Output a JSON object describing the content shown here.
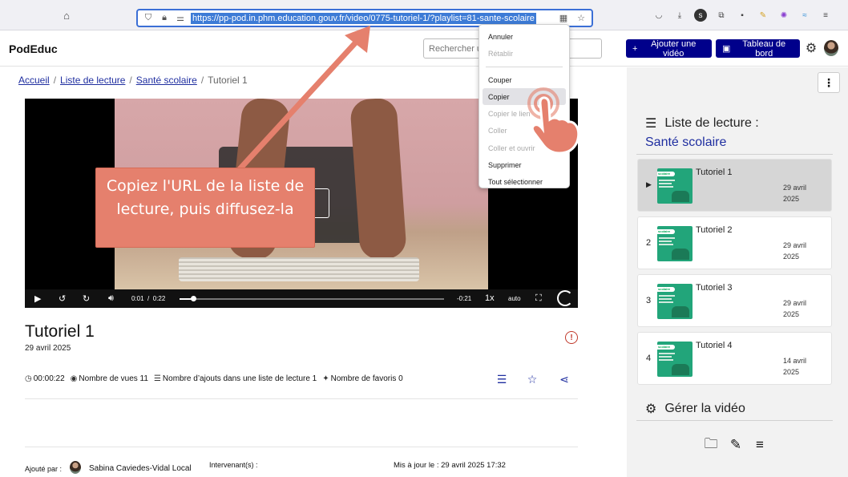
{
  "browser": {
    "url": "https://pp-pod.in.phm.education.gouv.fr/video/0775-tutoriel-1/?playlist=81-sante-scolaire"
  },
  "header": {
    "brand": "PodEduc",
    "search_placeholder": "Rechercher un",
    "add_video_label": "Ajouter une vidéo",
    "dashboard_label": "Tableau de bord"
  },
  "breadcrumb": {
    "home": "Accueil",
    "playlists": "Liste de lecture",
    "playlist": "Santé scolaire",
    "current": "Tutoriel 1"
  },
  "player": {
    "time_current": "0:01",
    "time_separator": "/",
    "time_total": "0:22",
    "time_remaining": "-0:21",
    "speed": "1x",
    "quality": "auto",
    "progress": 0.05
  },
  "callout": {
    "text": "Copiez l'URL de la liste de lecture, puis diffusez-la"
  },
  "context_menu": {
    "items": [
      {
        "label": "Annuler",
        "disabled": false
      },
      {
        "label": "Rétablir",
        "disabled": true
      },
      {
        "label": "Couper",
        "disabled": false
      },
      {
        "label": "Copier",
        "disabled": false
      },
      {
        "label": "Copier le lien",
        "disabled": true
      },
      {
        "label": "Coller",
        "disabled": true
      },
      {
        "label": "Coller et ouvrir",
        "disabled": true
      },
      {
        "label": "Supprimer",
        "disabled": false
      },
      {
        "label": "Tout sélectionner",
        "disabled": false
      }
    ]
  },
  "video": {
    "title": "Tutoriel 1",
    "date": "29 avril 2025",
    "duration": "00:00:22",
    "views": "Nombre de vues 11",
    "playlist_adds": "Nombre d’ajouts dans une liste de lecture 1",
    "favorites": "Nombre de favoris 0",
    "added_by_label": "Ajouté par :",
    "added_by_name": "Sabina Caviedes-Vidal Local",
    "speakers_label": "Intervenant(s) :",
    "updated": "Mis à jour le : 29 avril 2025 17:32"
  },
  "sidebar": {
    "playlist_heading": "Liste de lecture :",
    "playlist_name": "Santé scolaire",
    "items": [
      {
        "num": "▶",
        "title": "Tutoriel 1",
        "date": "29 avril 2025",
        "active": true
      },
      {
        "num": "2",
        "title": "Tutoriel 2",
        "date": "29 avril 2025",
        "active": false
      },
      {
        "num": "3",
        "title": "Tutoriel 3",
        "date": "29 avril 2025",
        "active": false
      },
      {
        "num": "4",
        "title": "Tutoriel 4",
        "date": "14 avril 2025",
        "active": false
      }
    ],
    "manage_heading": "Gérer la vidéo"
  },
  "colors": {
    "brand_blue": "#00008b",
    "link_blue": "#1f2ea0",
    "callout": "#e5806d"
  }
}
